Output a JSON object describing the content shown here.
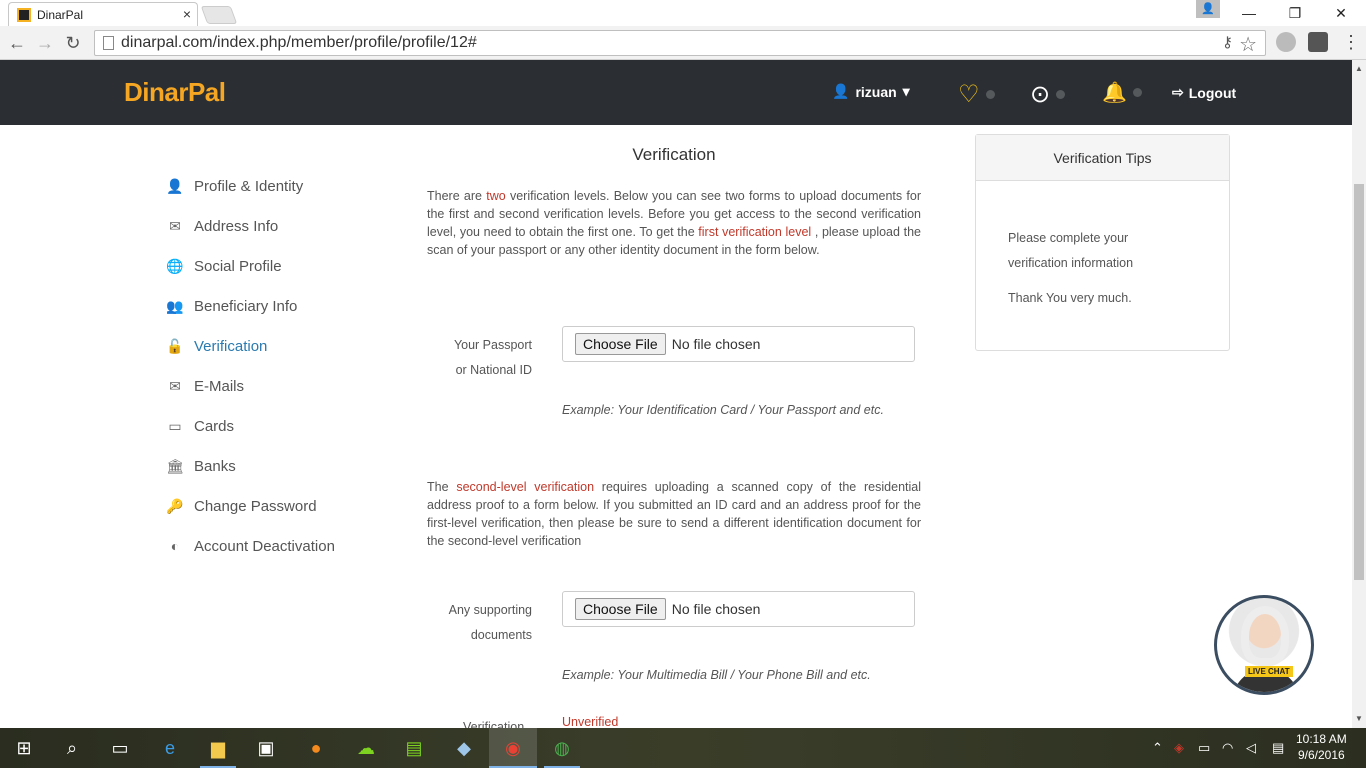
{
  "browser": {
    "tab_title": "DinarPal",
    "tab_close": "×",
    "url": "dinarpal.com/index.php/member/profile/profile/12#",
    "win_min": "—",
    "win_restore": "❐",
    "win_close": "✕",
    "back": "←",
    "forward": "→",
    "reload": "↻",
    "star": "☆",
    "key": "⚷",
    "menu": "⋮"
  },
  "header": {
    "logo": "DinarPal",
    "username": "rizuan",
    "caret": "▾",
    "logout": "Logout",
    "heart": "♡",
    "lifebuoy": "⊙",
    "bell": "🔔",
    "logout_icon": "⇨"
  },
  "sidebar": {
    "items": [
      {
        "label": "Profile & Identity",
        "icon": "👤"
      },
      {
        "label": "Address Info",
        "icon": "✉"
      },
      {
        "label": "Social Profile",
        "icon": "🌐"
      },
      {
        "label": "Beneficiary Info",
        "icon": "👥"
      },
      {
        "label": "Verification",
        "icon": "🔓"
      },
      {
        "label": "E-Mails",
        "icon": "✉"
      },
      {
        "label": "Cards",
        "icon": "▭"
      },
      {
        "label": "Banks",
        "icon": "🏛"
      },
      {
        "label": "Change Password",
        "icon": "🔑"
      },
      {
        "label": "Account Deactivation",
        "icon": "◐"
      }
    ]
  },
  "main": {
    "title": "Verification",
    "intro_1": "There are ",
    "intro_hl1": "two",
    "intro_2": " verification levels. Below you can see two forms to upload documents for the first and second verification levels. Before you get access to the second verification level, you need to obtain the first one. To get the ",
    "intro_hl2": "first verification level",
    "intro_3": " , please upload the scan of your passport or any other identity document in the form below.",
    "field1_label_line1": "Your Passport",
    "field1_label_line2": "or National ID",
    "choose_file": "Choose File",
    "no_file": "No file chosen",
    "example1": "Example: Your Identification Card / Your Passport and etc.",
    "second_1": "The ",
    "second_hl": "second-level verification",
    "second_2": " requires uploading a scanned copy of the residential address proof to a form below. If you submitted an ID card and an address proof for the first-level verification, then please be sure to send a different identification document for the second-level verification",
    "field2_label_line1": "Any supporting",
    "field2_label_line2": "documents",
    "example2": "Example: Your Multimedia Bill / Your Phone Bill and etc.",
    "status_label": "Verification",
    "status_value": "Unverified"
  },
  "tips": {
    "title": "Verification Tips",
    "line1": "Please complete your",
    "line2": "verification information",
    "line3": "Thank You very much."
  },
  "livechat": {
    "label": "LIVE CHAT"
  },
  "taskbar": {
    "time": "10:18 AM",
    "date": "9/6/2016"
  }
}
